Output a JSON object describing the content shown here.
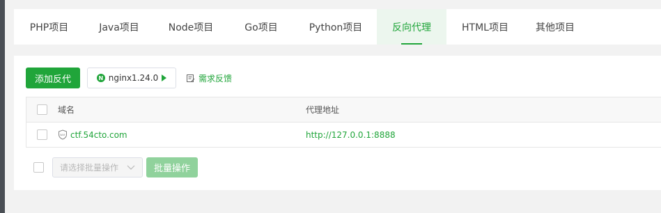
{
  "tabs": [
    {
      "label": "PHP项目",
      "active": false
    },
    {
      "label": "Java项目",
      "active": false
    },
    {
      "label": "Node项目",
      "active": false
    },
    {
      "label": "Go项目",
      "active": false
    },
    {
      "label": "Python项目",
      "active": false
    },
    {
      "label": "反向代理",
      "active": true
    },
    {
      "label": "HTML项目",
      "active": false
    },
    {
      "label": "其他项目",
      "active": false
    }
  ],
  "toolbar": {
    "add_label": "添加反代",
    "nginx_logo": "N",
    "nginx_label": "nginx1.24.0",
    "feedback_label": "需求反馈"
  },
  "table": {
    "headers": {
      "domain": "域名",
      "proxy": "代理地址"
    },
    "rows": [
      {
        "domain": "ctf.54cto.com",
        "proxy": "http://127.0.0.1:8888"
      }
    ]
  },
  "footer": {
    "select_placeholder": "请选择批量操作",
    "batch_label": "批量操作"
  },
  "colors": {
    "accent": "#20a53a",
    "accent_light": "#ecf6ee"
  }
}
